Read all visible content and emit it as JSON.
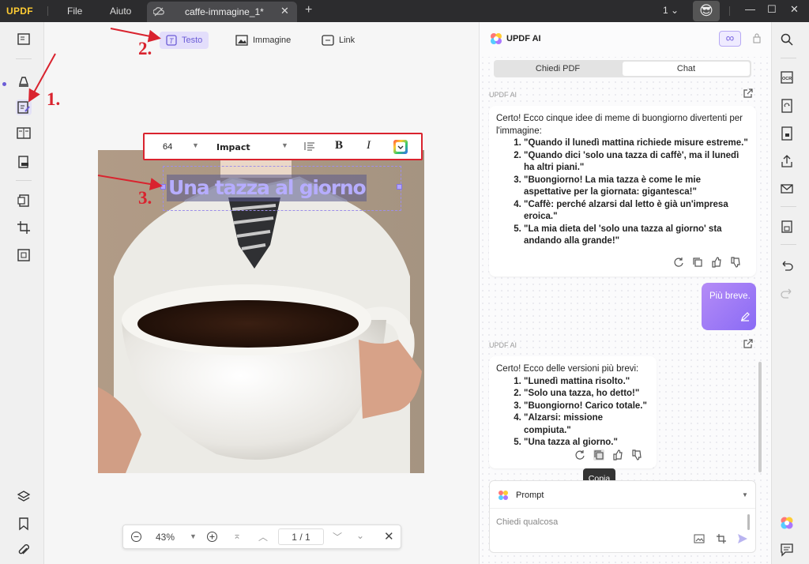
{
  "app": {
    "logo": "UPDF",
    "menu": [
      "File",
      "Aiuto"
    ],
    "tab_title": "caffe-immagine_1*",
    "page_count": "1",
    "avatar": "😎"
  },
  "edit_toolbar": {
    "text": "Testo",
    "image": "Immagine",
    "link": "Link"
  },
  "format_bar": {
    "size": "64",
    "font": "Impact",
    "bold": "B",
    "italic": "I"
  },
  "canvas": {
    "selected_text": "Una tazza al giorno"
  },
  "annotations": [
    "1.",
    "2.",
    "3."
  ],
  "zoom": {
    "level": "43%",
    "page_current": "1",
    "page_sep": "/",
    "page_total": "1"
  },
  "ai": {
    "title": "UPDF AI",
    "infinity": "∞",
    "tabs": [
      "Chiedi PDF",
      "Chat"
    ],
    "source_label": "UPDF AI",
    "msg1": {
      "intro": "Certo! Ecco cinque idee di meme di buongiorno divertenti per l'immagine:",
      "items": [
        "\"Quando il lunedì mattina richiede misure estreme.\"",
        "\"Quando dici 'solo una tazza di caffè', ma il lunedì ha altri piani.\"",
        "\"Buongiorno! La mia tazza è come le mie aspettative per la giornata: gigantesca!\"",
        "\"Caffè: perché alzarsi dal letto è già un'impresa eroica.\"",
        "\"La mia dieta del 'solo una tazza al giorno' sta andando alla grande!\""
      ]
    },
    "user_msg": "Più breve.",
    "msg2": {
      "intro": "Certo! Ecco delle versioni più brevi:",
      "items": [
        "\"Lunedì mattina risolto.\"",
        "\"Solo una tazza, ho detto!\"",
        "\"Buongiorno! Carico totale.\"",
        "\"Alzarsi: missione compiuta.\"",
        "\"Una tazza al giorno.\""
      ]
    },
    "tooltip": "Copia",
    "prompt_label": "Prompt",
    "input_placeholder": "Chiedi qualcosa"
  }
}
